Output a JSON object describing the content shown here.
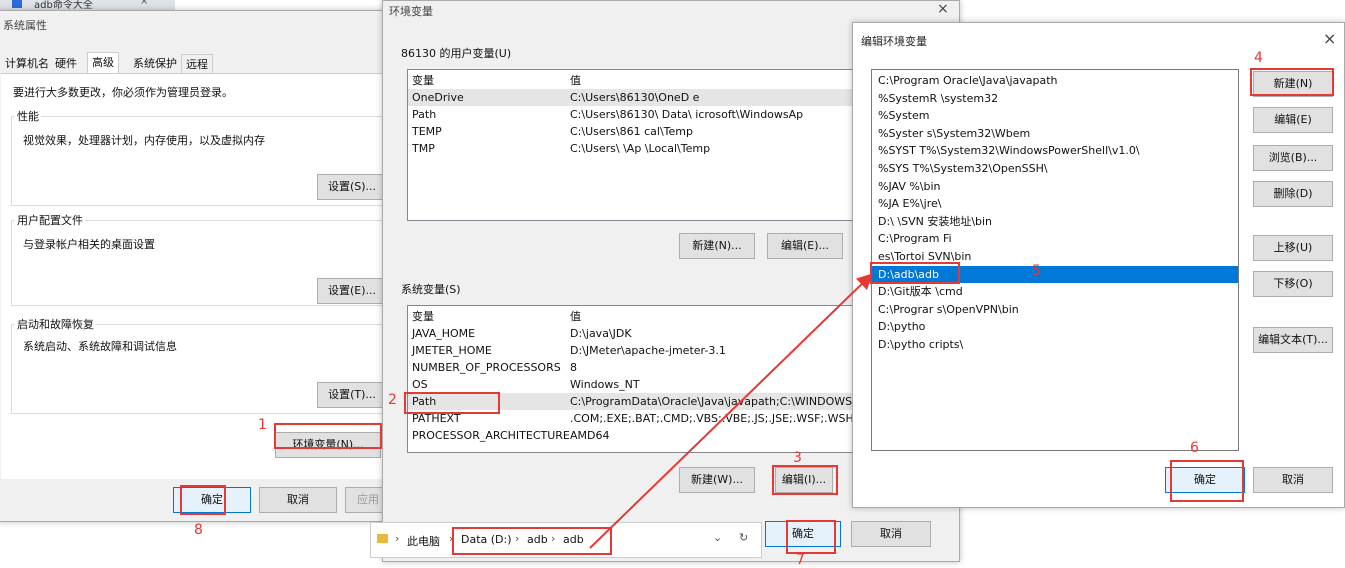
{
  "browser_tab": {
    "label": "adb命令大全"
  },
  "sysprops": {
    "title": "系统属性",
    "tabs": [
      "计算机名",
      "硬件",
      "高级",
      "系统保护",
      "远程"
    ],
    "active_tab": 2,
    "admin_note": "要进行大多数更改，你必须作为管理员登录。",
    "perf": {
      "label": "性能",
      "desc": "视觉效果，处理器计划，内存使用，以及虚拟内存",
      "btn": "设置(S)..."
    },
    "profile": {
      "label": "用户配置文件",
      "desc": "与登录帐户相关的桌面设置",
      "btn": "设置(E)..."
    },
    "startup": {
      "label": "启动和故障恢复",
      "desc": "系统启动、系统故障和调试信息",
      "btn": "设置(T)..."
    },
    "env_btn": "环境变量(N)...",
    "ok": "确定",
    "cancel": "取消",
    "apply": "应用"
  },
  "envvars": {
    "title": "环境变量",
    "user_label": "86130 的用户变量(U)",
    "col_var": "变量",
    "col_val": "值",
    "user_rows": [
      {
        "name": "OneDrive",
        "value": "C:\\Users\\86130\\OneD    e"
      },
      {
        "name": "Path",
        "value": "C:\\Users\\86130\\    Data\\    icrosoft\\WindowsAp"
      },
      {
        "name": "TEMP",
        "value": "C:\\Users\\861        cal\\Temp"
      },
      {
        "name": "TMP",
        "value": "C:\\Users\\        \\Ap       \\Local\\Temp"
      }
    ],
    "user_new": "新建(N)...",
    "user_edit": "编辑(E)...",
    "sys_label": "系统变量(S)",
    "sys_rows": [
      {
        "name": "JAVA_HOME",
        "value": "D:\\java\\JDK"
      },
      {
        "name": "JMETER_HOME",
        "value": "D:\\JMeter\\apache-jmeter-3.1"
      },
      {
        "name": "NUMBER_OF_PROCESSORS",
        "value": "8"
      },
      {
        "name": "OS",
        "value": "Windows_NT"
      },
      {
        "name": "Path",
        "value": "C:\\ProgramData\\Oracle\\Java\\javapath;C:\\WINDOWS\\sy"
      },
      {
        "name": "PATHEXT",
        "value": ".COM;.EXE;.BAT;.CMD;.VBS;.VBE;.JS;.JSE;.WSF;.WSH;.MS"
      },
      {
        "name": "PROCESSOR_ARCHITECTURE",
        "value": "AMD64"
      }
    ],
    "sys_new": "新建(W)...",
    "sys_edit": "编辑(I)...",
    "ok": "确定",
    "cancel": "取消"
  },
  "editenv": {
    "title": "编辑环境变量",
    "items": [
      "C:\\Program        Oracle\\Java\\javapath",
      "%SystemR         \\system32",
      "%System",
      "%Syster          s\\System32\\Wbem",
      "%SYST         T%\\System32\\WindowsPowerShell\\v1.0\\",
      "%SYS         T%\\System32\\OpenSSH\\",
      "%JAV          %\\bin",
      "%JA           E%\\jre\\",
      "D:\\           \\SVN         安装地址\\bin",
      "C:\\Program Fi",
      "es\\Tortoi    SVN\\bin",
      "D:\\adb\\adb",
      "D:\\Git版本         \\cmd",
      "C:\\Prograr       s\\OpenVPN\\bin",
      "D:\\pytho",
      "D:\\pytho       cripts\\"
    ],
    "selected": 11,
    "btn_new": "新建(N)",
    "btn_edit": "编辑(E)",
    "btn_browse": "浏览(B)...",
    "btn_delete": "删除(D)",
    "btn_up": "上移(U)",
    "btn_down": "下移(O)",
    "btn_edit_text": "编辑文本(T)...",
    "ok": "确定",
    "cancel": "取消"
  },
  "explorer": {
    "crumbs": [
      "此电脑",
      "Data (D:)",
      "adb",
      "adb"
    ]
  },
  "annotations": [
    "1",
    "2",
    "3",
    "4",
    "5",
    "6",
    "7",
    "8"
  ],
  "colors": {
    "annotation": "#e53935",
    "selection": "#0078d7"
  }
}
